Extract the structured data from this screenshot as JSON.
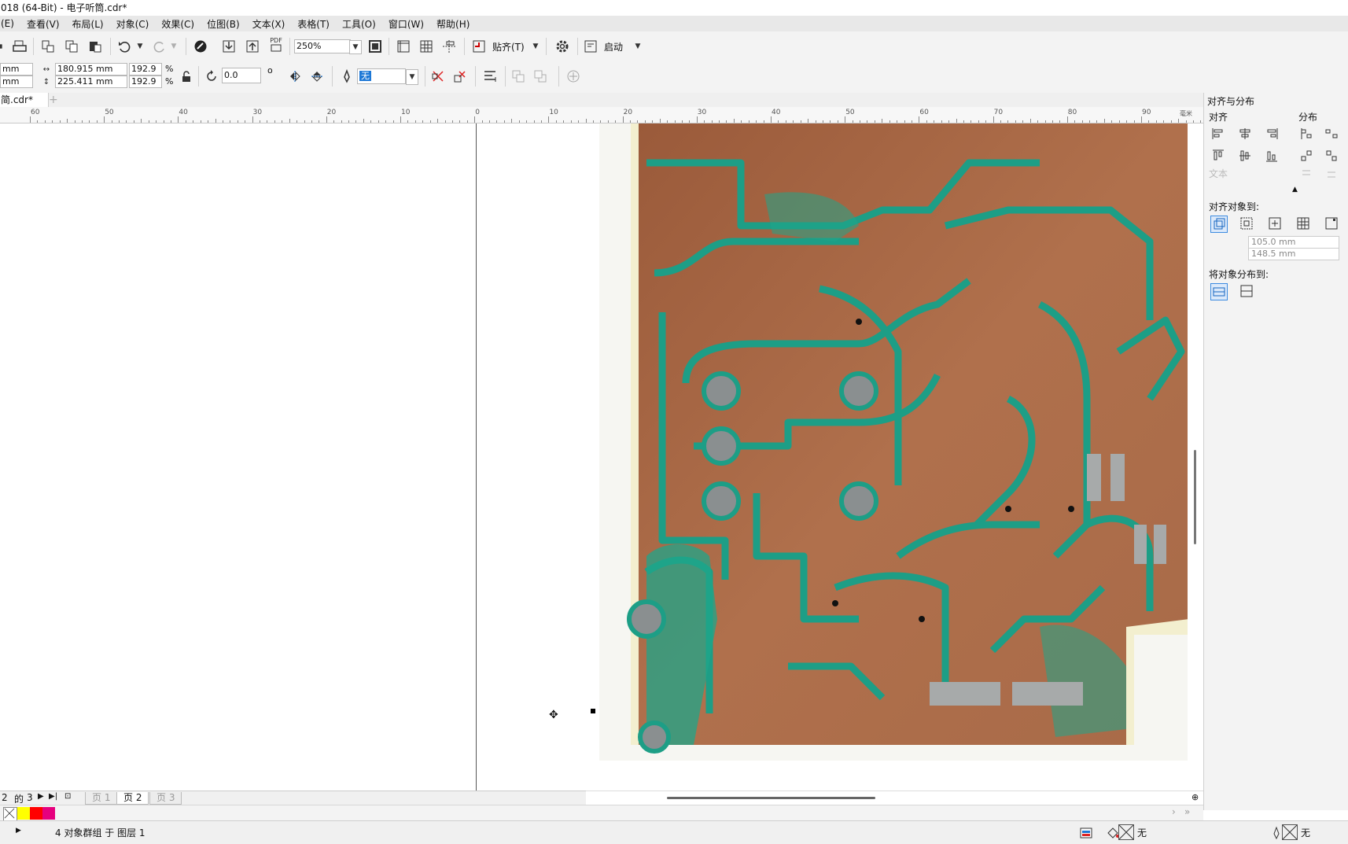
{
  "title": "018 (64-Bit) - 电子听筒.cdr*",
  "menu": [
    "(E)",
    "查看(V)",
    "布局(L)",
    "对象(C)",
    "效果(C)",
    "位图(B)",
    "文本(X)",
    "表格(T)",
    "工具(O)",
    "窗口(W)",
    "帮助(H)"
  ],
  "toolbar": {
    "pdf_label": "PDF",
    "zoom_value": "250%",
    "snap_label": "贴齐(T)",
    "launch_label": "启动"
  },
  "propbar": {
    "x_unit_top": "mm",
    "y_unit_bottom": "mm",
    "width": "180.915 mm",
    "height": "225.411 mm",
    "scale_x": "192.9",
    "scale_y": "192.9",
    "percent": "%",
    "rotation": "0.0",
    "degree": "o",
    "outline": "无"
  },
  "doc_tab": "简.cdr*",
  "ruler": {
    "labels": [
      "60",
      "50",
      "40",
      "30",
      "20",
      "10",
      "0",
      "10",
      "20",
      "30",
      "40",
      "50",
      "60",
      "70",
      "80",
      "90"
    ],
    "unit": "毫米"
  },
  "panel": {
    "title": "对齐与分布",
    "align_label": "对齐",
    "distribute_label": "分布",
    "text_label": "文本",
    "align_to_label": "对齐对象到:",
    "x_value": "105.0 mm",
    "y_value": "148.5 mm",
    "distribute_to_label": "将对象分布到:"
  },
  "pagenav": {
    "counter_a": "2",
    "counter_of": "的",
    "counter_b": "3",
    "pages": [
      "页 1",
      "页 2",
      "页 3"
    ]
  },
  "palette": {
    "colors": [
      "#ffff00",
      "#ff0000",
      "#e6007e"
    ]
  },
  "status": {
    "message": "4 对象群组 于 图层 1",
    "fill_value": "无",
    "outline_value": "无"
  }
}
